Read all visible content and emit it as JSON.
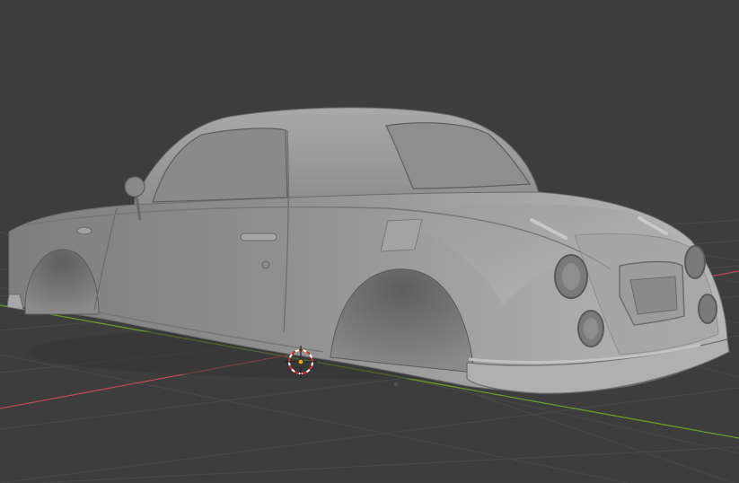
{
  "viewport": {
    "background_color": "#3d3d3d",
    "grid_color": "#484848",
    "x_axis_color": "#b84a56",
    "y_axis_color": "#6a9a2a",
    "object": "car-body-mesh",
    "object_color": "#9a9a9a",
    "cursor_icon": "3d-cursor-icon",
    "origin_icon": "object-origin-icon"
  }
}
